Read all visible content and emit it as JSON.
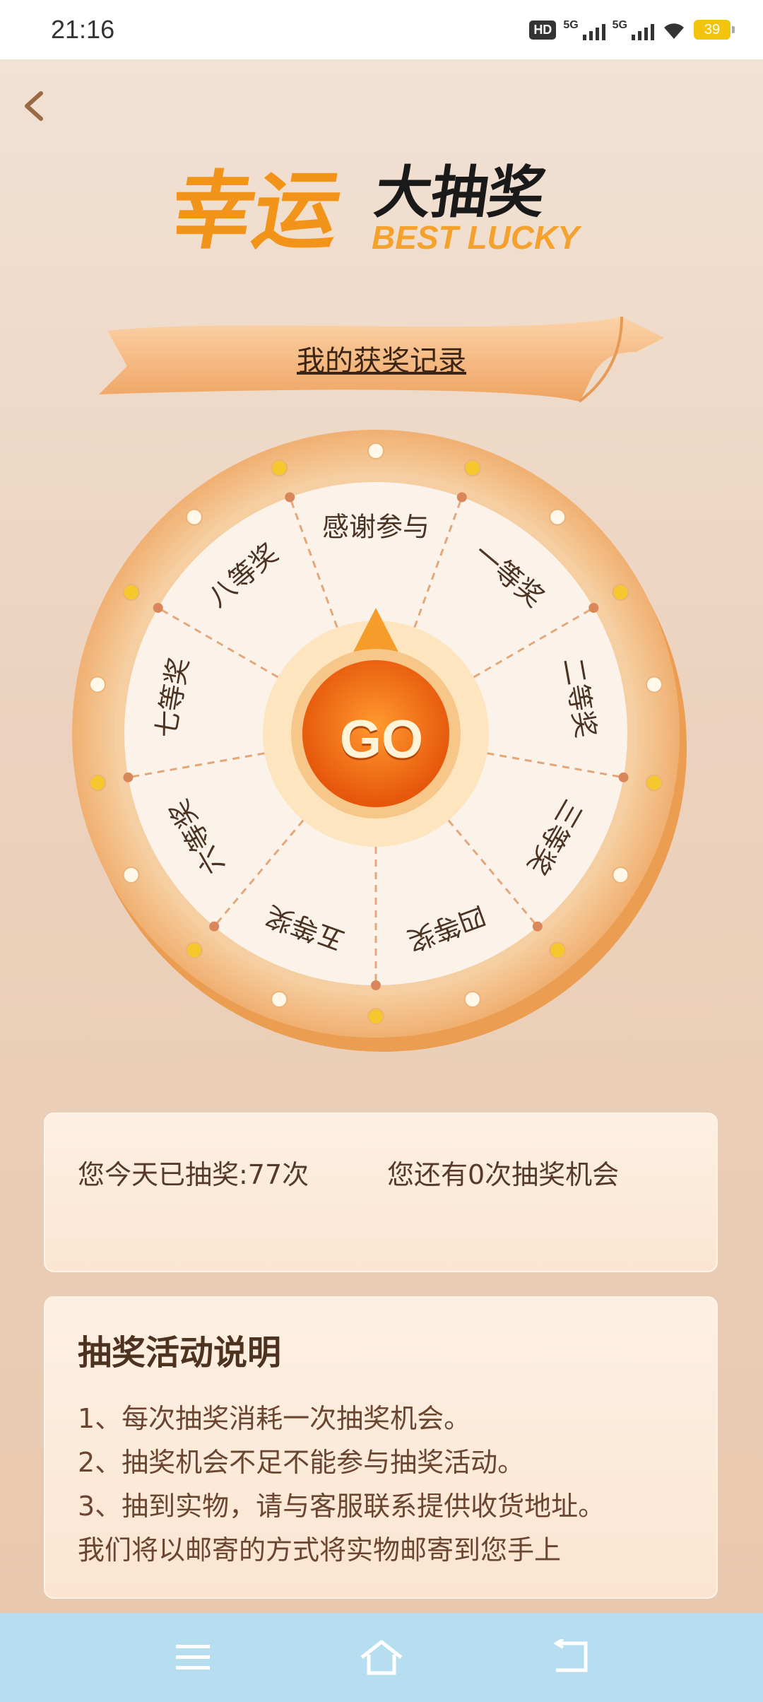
{
  "status_bar": {
    "time": "21:16",
    "hd_label": "HD",
    "sim1": "5G",
    "sim2": "5G",
    "battery": "39"
  },
  "header": {
    "back_icon": "chevron-left-icon",
    "logo_text_cn": "幸运大抽奖",
    "logo_text_en": "BEST LUCKY"
  },
  "record_link": "我的获奖记录",
  "wheel": {
    "go_label": "GO",
    "prizes": [
      "感谢参与",
      "一等奖",
      "二等奖",
      "三等奖",
      "四等奖",
      "五等奖",
      "六等奖",
      "七等奖",
      "八等奖"
    ]
  },
  "draw_info": {
    "today": "您今天已抽奖:77次",
    "remaining": "您还有0次抽奖机会"
  },
  "rules": {
    "title": "抽奖活动说明",
    "items": [
      "1、每次抽奖消耗一次抽奖机会。",
      "2、抽奖机会不足不能参与抽奖活动。",
      "3、抽到实物，请与客服联系提供收货地址。",
      "我们将以邮寄的方式将实物邮寄到您手上"
    ]
  },
  "nav_bar": {
    "menu_icon": "menu-icon",
    "home_icon": "home-icon",
    "back_icon": "back-icon"
  },
  "colors": {
    "accent": "#f08a1c",
    "card": "#fbe6d3",
    "nav": "#b6ddf0"
  }
}
